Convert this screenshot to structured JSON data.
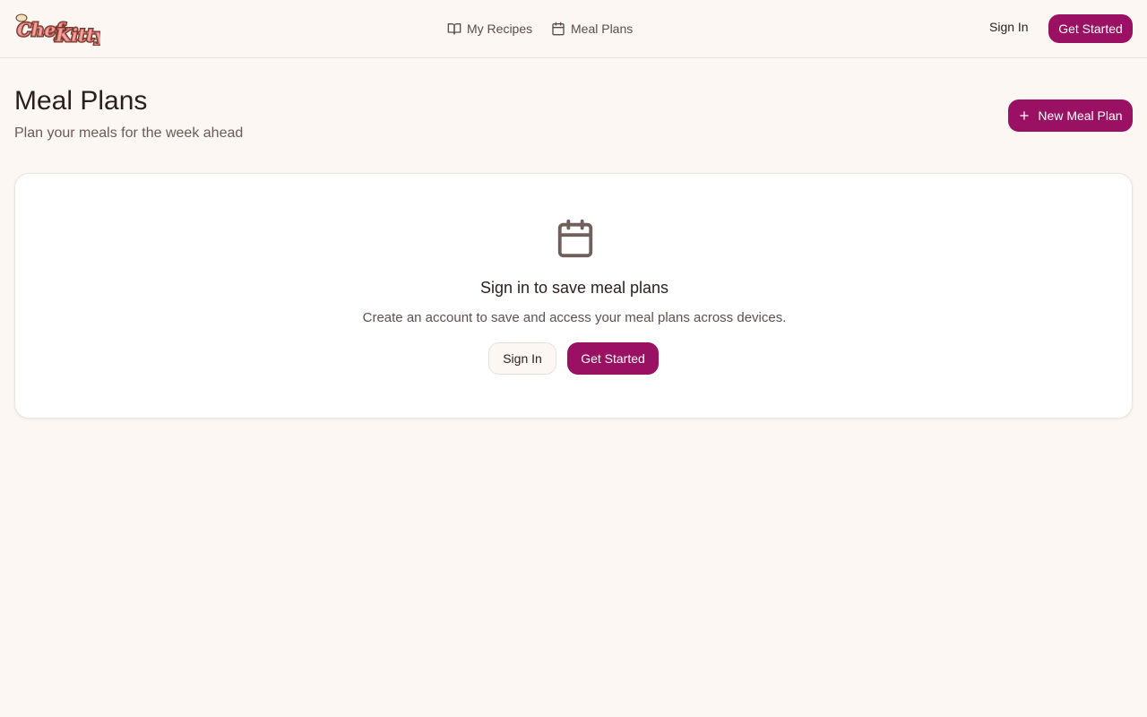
{
  "brand": {
    "logo_text": "Chef Kitty",
    "accent": "#9a1063"
  },
  "nav": {
    "items": [
      {
        "label": "My Recipes",
        "icon": "book-open-icon"
      },
      {
        "label": "Meal Plans",
        "icon": "calendar-icon"
      }
    ],
    "sign_in_label": "Sign In",
    "get_started_label": "Get Started"
  },
  "page": {
    "title": "Meal Plans",
    "subtitle": "Plan your meals for the week ahead",
    "new_button_label": "New Meal Plan"
  },
  "empty_state": {
    "icon": "calendar-icon",
    "title": "Sign in to save meal plans",
    "description": "Create an account to save and access your meal plans across devices.",
    "sign_in_label": "Sign In",
    "get_started_label": "Get Started"
  }
}
